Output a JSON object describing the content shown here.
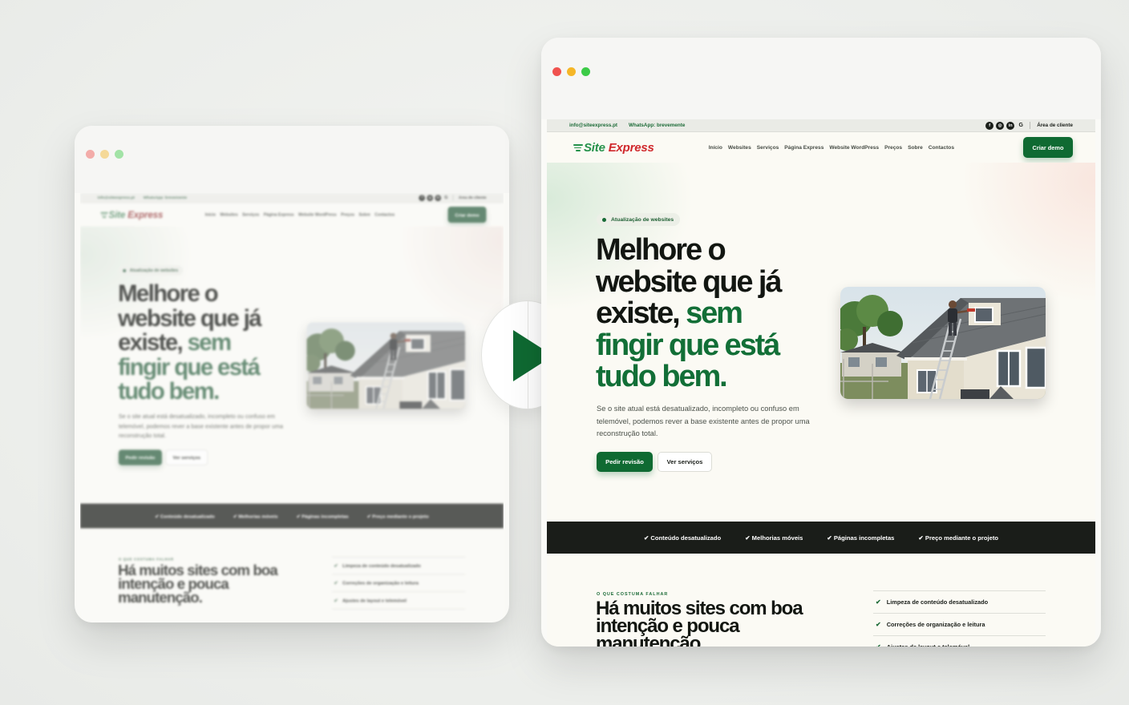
{
  "site": {
    "topbar": {
      "email": "info@siteexpress.pt",
      "whatsapp": "WhatsApp: brevemente",
      "social_icons": [
        "facebook-icon",
        "instagram-icon",
        "linkedin-icon",
        "google-icon"
      ],
      "client_area": "Área de cliente"
    },
    "logo": {
      "part1": "Site",
      "part2": "Express"
    },
    "nav": {
      "links": [
        "Início",
        "Websites",
        "Serviços",
        "Página Express",
        "Website WordPress",
        "Preços",
        "Sobre",
        "Contactos"
      ],
      "cta": "Criar demo"
    },
    "hero": {
      "badge": "Atualização de websites",
      "title_dark": "Melhore o website que já existe,",
      "title_green": "sem fingir que está tudo bem.",
      "description": "Se o site atual está desatualizado, incompleto ou confuso em telemóvel, podemos rever a base existente antes de propor uma reconstrução total.",
      "primary_button": "Pedir revisão",
      "secondary_button": "Ver serviços"
    },
    "strip": {
      "items": [
        "✔ Conteúdo desatualizado",
        "✔ Melhorias móveis",
        "✔ Páginas incompletas",
        "✔ Preço mediante o projeto"
      ]
    },
    "section": {
      "eyebrow": "O QUE COSTUMA FALHAR",
      "title": "Há muitos sites com boa intenção e pouca manutenção.",
      "checklist": [
        "Limpeza de conteúdo desatualizado",
        "Correções de organização e leitura",
        "Ajustes de layout e telemóvel"
      ]
    }
  },
  "colors": {
    "brand_green": "#0f6a32",
    "logo_red": "#d0282c",
    "strip_dark": "#1a1d19",
    "play_icon": "#0f6a32"
  }
}
